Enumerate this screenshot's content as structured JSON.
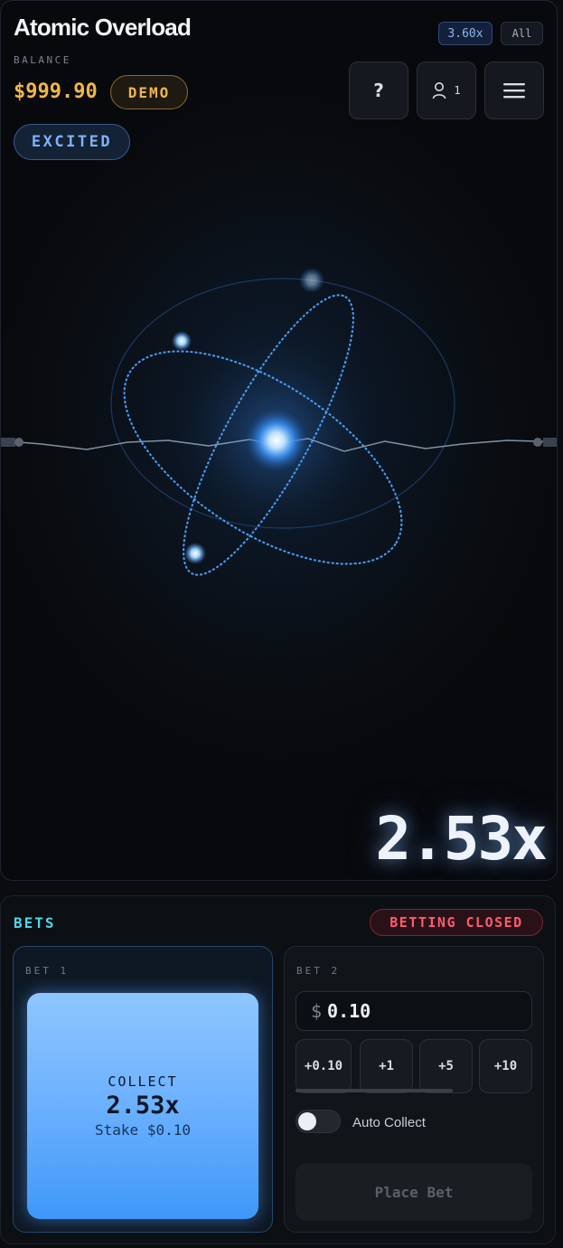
{
  "header": {
    "title": "Atomic Overload",
    "balance_label": "BALANCE",
    "balance": "$999.90",
    "mode_badge": "DEMO",
    "state_badge": "EXCITED",
    "multiplier_pill": "3.60x",
    "filter_pill": "All",
    "help_label": "?",
    "players_count": "1"
  },
  "game": {
    "current_multiplier": "2.53x"
  },
  "bets": {
    "title": "BETS",
    "status": "BETTING CLOSED",
    "bet1": {
      "label": "BET 1",
      "collect_label": "COLLECT",
      "collect_value": "2.53x",
      "stake_text": "Stake $0.10"
    },
    "bet2": {
      "label": "BET 2",
      "currency": "$",
      "amount": "0.10",
      "quick": [
        "+0.10",
        "+1",
        "+5",
        "+10"
      ],
      "auto_collect_label": "Auto Collect",
      "auto_collect_on": false,
      "place_label": "Place Bet"
    }
  },
  "icons": [
    "user-icon",
    "menu-icon",
    "atom-graphic"
  ],
  "colors": {
    "accent_gold": "#f2b64a",
    "accent_blue": "#7fb3f5",
    "bets_title": "#4fd6e8",
    "closed_red": "#ff5a6e",
    "collect_blue": "#6cb0ff"
  }
}
